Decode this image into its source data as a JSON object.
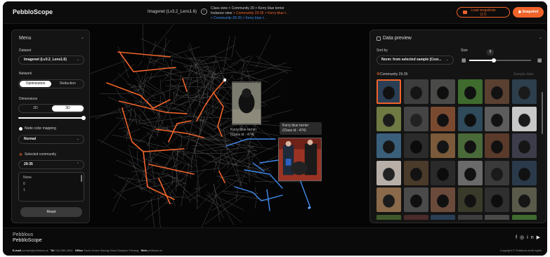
{
  "header": {
    "logo": "PebbloScope",
    "dataset_title": "Imagenet (Lv3.2_Lens1.6)",
    "class_view_label": "Class view",
    "class_view_value": "> Community 29 > Kerry blue terrier",
    "instance_view_label": "Instance view",
    "instance_view_value": "> Community 29-35 > Kerry blue t...",
    "instance_view_value_2": "> Community 29-20 > Kerry blue t...",
    "load_snapshots_label": "Load snapshots",
    "load_snapshots_count": "(17)",
    "snapshot_label": "Snapshot"
  },
  "menu": {
    "title": "Menu",
    "dataset_label": "Dataset",
    "dataset_value": "Imagenet (Lv3.2_Lens1.6)",
    "network_label": "Network",
    "network_options": [
      "Optimization",
      "Reduction"
    ],
    "network_selected": "Optimization",
    "dimensions_label": "Dimensions",
    "dimension_options": [
      "2D",
      "3D"
    ],
    "dimension_selected": "3D",
    "node_color_label": "Node color mapping",
    "node_color_value": "Normal",
    "selected_community_label": "Selected community",
    "selected_community_value": "29-35",
    "community_list": [
      "None",
      "0",
      "1"
    ],
    "reset_label": "Reset"
  },
  "preview": {
    "title": "Data preview",
    "sort_label": "Sort by",
    "sort_value": "Norm: from selected sample (Cosi...",
    "size_label": "Size",
    "size_value": "6",
    "size_fraction": 0.4,
    "community_label": "Community 29-35",
    "sample_label": "Sample data"
  },
  "graph": {
    "tooltip_primary_title": "Kerry blue terrier",
    "tooltip_primary_id": "(Class id : 474)",
    "tooltip_secondary_title": "Kerry blue terrier",
    "tooltip_secondary_id": "(Class id : 474)"
  },
  "colors": {
    "accent": "#f0632a",
    "edge_highlight_blue": "#3f8cf0",
    "background": "#050505"
  },
  "footer": {
    "logo_line1": "Pebblous",
    "logo_line2": "PebbloScope",
    "email_label": "E-mail",
    "email_value": "contact@pebblous.ai",
    "tel_label": "Tel",
    "tel_value": "044-589-2604",
    "office_label": "Office",
    "office_value": "South Korea  Sejong  Seoul  Daejeon  Pohang",
    "web_label": "Web",
    "web_value": "pebblous.ai",
    "copyright": "Copyright © Pebblous.ai  All rights",
    "social_icons": [
      "facebook-icon",
      "instagram-icon",
      "linkedin-icon",
      "youtube-icon"
    ]
  }
}
